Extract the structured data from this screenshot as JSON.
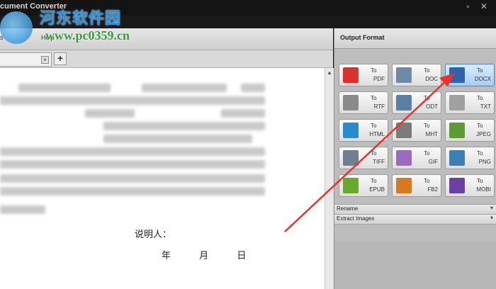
{
  "window": {
    "title": "cument Converter",
    "controls": "▫ ✕"
  },
  "watermark": {
    "site_name": "河东软件园",
    "url": "www.pc0359.cn"
  },
  "left_header": {
    "tab_fragment_a": "s",
    "tab_fragment_b": "Help"
  },
  "tabs": {
    "close_label": "×",
    "add_label": "+"
  },
  "document": {
    "signature_label": "说明人：",
    "date_year": "年",
    "date_month": "月",
    "date_day": "日"
  },
  "output_panel": {
    "title": "Output Format",
    "to_label": "To",
    "formats": [
      {
        "fmt": "PDF",
        "icon": "pdf-icon",
        "color": "#d8322c",
        "active": false
      },
      {
        "fmt": "DOC",
        "icon": "doc-icon",
        "color": "#6e8aa8",
        "active": false
      },
      {
        "fmt": "DOCX",
        "icon": "docx-icon",
        "color": "#2f63b0",
        "active": true
      },
      {
        "fmt": "RTF",
        "icon": "rtf-icon",
        "color": "#8a8a8a",
        "active": false
      },
      {
        "fmt": "ODT",
        "icon": "odt-icon",
        "color": "#5a7fa0",
        "active": false
      },
      {
        "fmt": "TXT",
        "icon": "txt-icon",
        "color": "#a0a0a0",
        "active": false
      },
      {
        "fmt": "HTML",
        "icon": "html-icon",
        "color": "#2a8ad0",
        "active": false
      },
      {
        "fmt": "MHT",
        "icon": "mht-icon",
        "color": "#7b7b7b",
        "active": false
      },
      {
        "fmt": "JPEG",
        "icon": "jpeg-icon",
        "color": "#5f9a3a",
        "active": false
      },
      {
        "fmt": "TIFF",
        "icon": "tiff-icon",
        "color": "#6f7f90",
        "active": false
      },
      {
        "fmt": "GIF",
        "icon": "gif-icon",
        "color": "#9c6bbf",
        "active": false
      },
      {
        "fmt": "PNG",
        "icon": "png-icon",
        "color": "#3d7fb0",
        "active": false
      },
      {
        "fmt": "EPUB",
        "icon": "epub-icon",
        "color": "#6aa72f",
        "active": false
      },
      {
        "fmt": "FB2",
        "icon": "fb2-icon",
        "color": "#d9781e",
        "active": false
      },
      {
        "fmt": "MOBI",
        "icon": "mobi-icon",
        "color": "#6b3fa3",
        "active": false
      }
    ],
    "rename_label": "Rename",
    "extract_label": "Extract Images"
  },
  "colors": {
    "accent": "#4d86c4",
    "annotation_arrow": "#e8322a"
  }
}
